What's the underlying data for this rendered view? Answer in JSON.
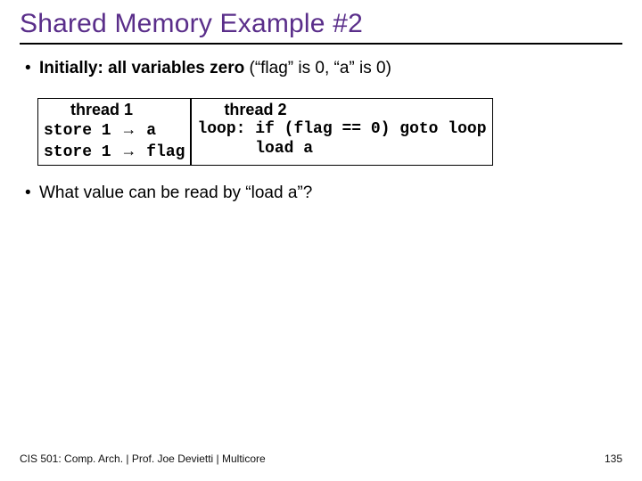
{
  "title": "Shared Memory Example #2",
  "bullets": {
    "b1_strong": "Initially: all variables zero",
    "b1_rest": " (“flag” is 0, “a” is 0)",
    "b2": "What value can be read by “load a”?"
  },
  "code": {
    "t1_header": "thread 1",
    "t1_l1_a": "store 1 ",
    "t1_l1_b": " a",
    "t1_l2_a": "store 1 ",
    "t1_l2_b": " flag",
    "t2_header": "thread 2",
    "t2_l1": "loop: if (flag == 0) goto loop",
    "t2_l2": "      load a"
  },
  "arrow": "→",
  "dot": "•",
  "footer": {
    "left": "CIS 501: Comp. Arch.  |  Prof. Joe Devietti  |  Multicore",
    "right": "135"
  }
}
